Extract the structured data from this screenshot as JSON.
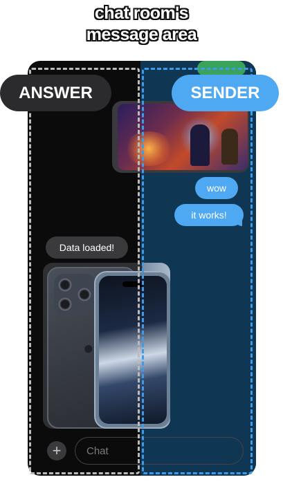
{
  "header": {
    "title_line1": "chat room's",
    "title_line2": "message area"
  },
  "labels": {
    "answer": "ANSWER",
    "sender": "SENDER"
  },
  "messages": {
    "sent_image": "game-art-image",
    "sent": [
      "wow",
      "it works!"
    ],
    "received_text": "Data loaded!",
    "received_image": "iphone-image"
  },
  "composer": {
    "add_icon": "plus-icon",
    "placeholder": "Chat"
  },
  "colors": {
    "sender_accent": "#4ea8f2",
    "answer_bubble": "#3a3a3c",
    "background_dark": "#0b0b0c"
  }
}
